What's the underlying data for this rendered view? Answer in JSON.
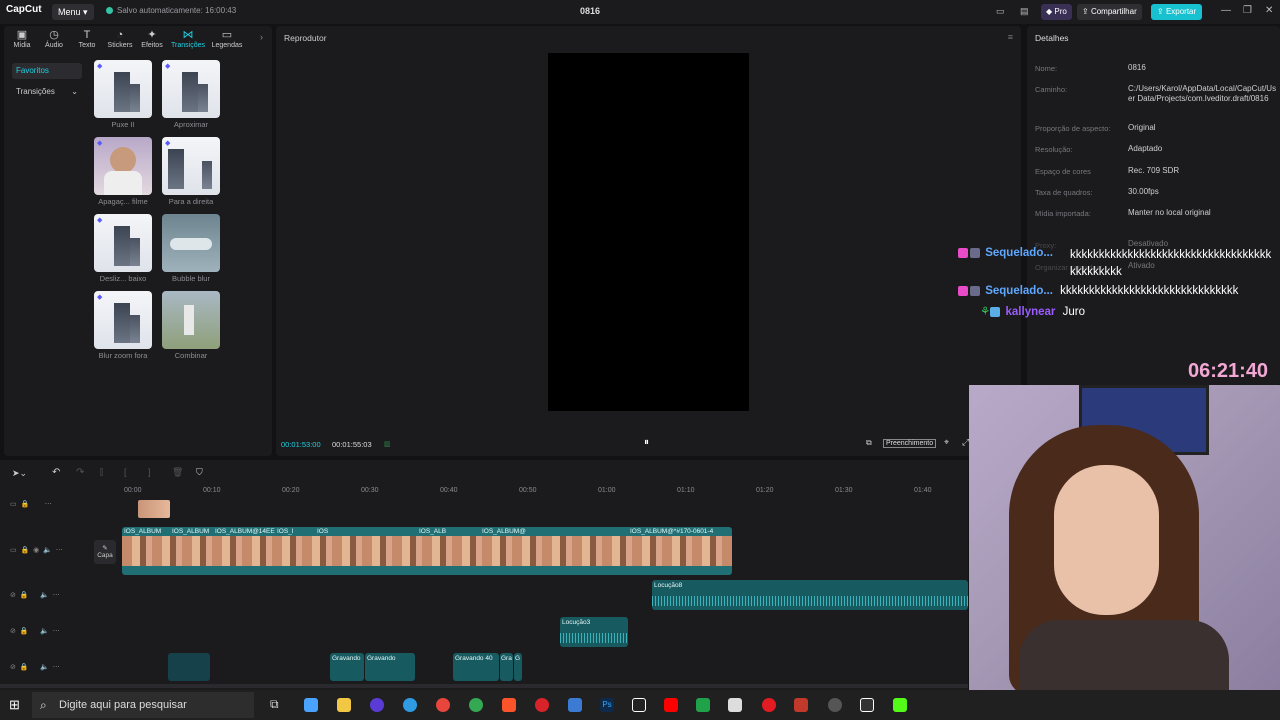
{
  "app": {
    "logo": "CapCut",
    "menu_label": "Menu",
    "save_status": "Salvo automaticamente: 16:00:43",
    "project_title": "0816",
    "pro_label": "Pro",
    "share_label": "Compartilhar",
    "export_label": "Exportar"
  },
  "toolbar": {
    "items": [
      {
        "label": "Mídia",
        "icon": "media-icon"
      },
      {
        "label": "Áudio",
        "icon": "audio-icon"
      },
      {
        "label": "Texto",
        "icon": "text-icon"
      },
      {
        "label": "Stickers",
        "icon": "sticker-icon"
      },
      {
        "label": "Efeitos",
        "icon": "effects-icon"
      },
      {
        "label": "Transições",
        "icon": "transitions-icon",
        "active": true
      },
      {
        "label": "Legendas",
        "icon": "captions-icon"
      }
    ]
  },
  "left_sidebar": {
    "favorites": "Favoritos",
    "transitions": "Transições"
  },
  "transitions_grid": [
    {
      "label": "Puxe II"
    },
    {
      "label": "Aproximar"
    },
    {
      "label": "Apagaç... filme"
    },
    {
      "label": "Para a direita"
    },
    {
      "label": "Desliz... baixo"
    },
    {
      "label": "Bubble blur"
    },
    {
      "label": "Blur zoom fora"
    },
    {
      "label": "Combinar"
    }
  ],
  "player": {
    "title": "Reprodutor",
    "current_time": "00:01:53:00",
    "total_time": "00:01:55:03",
    "fill_label": "Preenchimento"
  },
  "details": {
    "title": "Detalhes",
    "rows": [
      {
        "label": "Nome:",
        "value": "0816"
      },
      {
        "label": "Caminho:",
        "value": "C:/Users/Karol/AppData/Local/CapCut/User Data/Projects/com.lveditor.draft/0816"
      },
      {
        "label": "Proporção de aspecto:",
        "value": "Original"
      },
      {
        "label": "Resolução:",
        "value": "Adaptado"
      },
      {
        "label": "Espaço de cores",
        "value": "Rec. 709 SDR"
      },
      {
        "label": "Taxa de quadros:",
        "value": "30.00fps"
      },
      {
        "label": "Mídia importada:",
        "value": "Manter no local original"
      },
      {
        "label": "Proxy:",
        "value": "Desativado"
      },
      {
        "label": "Organizar camadas:",
        "value": "Ativado"
      }
    ]
  },
  "chat": [
    {
      "user": "Sequelado...",
      "message": "kkkkkkkkkkkkkkkkkkkkkkkkkkkkkkkkkkkkkkkkkkkk"
    },
    {
      "user": "Sequelado...",
      "message": "kkkkkkkkkkkkkkkkkkkkkkkkkkkkkkk"
    },
    {
      "user": "kallynear",
      "message": "Juro"
    }
  ],
  "stream_clock": "06:21:40",
  "timeline": {
    "ruler": [
      "00:00",
      "00:10",
      "00:20",
      "00:30",
      "00:40",
      "00:50",
      "01:00",
      "01:10",
      "01:20",
      "01:30",
      "01:40"
    ],
    "cover_label": "Capa",
    "video_clip_labels": [
      "IOS_ALBUM",
      "IOS_ALBUM",
      "IOS_ALBUM@14EE",
      "IOS_I",
      "IOS",
      "IOS_ALB",
      "IOS_ALBUM@",
      "IOS_ALBUM@*#170-0601-4"
    ],
    "audio_clips": [
      {
        "label": "Locução8"
      },
      {
        "label": "Locução3"
      },
      {
        "label": "Gravando"
      },
      {
        "label": "Gravando"
      },
      {
        "label": "Gravando 40"
      },
      {
        "label": "Gra"
      },
      {
        "label": "G"
      }
    ]
  },
  "taskbar": {
    "search_placeholder": "Digite aqui para pesquisar"
  }
}
